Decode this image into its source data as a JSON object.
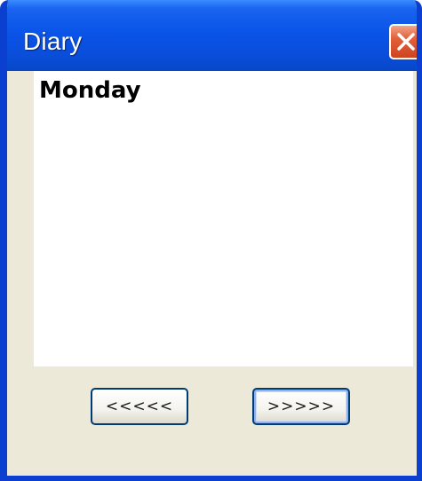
{
  "window": {
    "title": "Diary",
    "close_icon": "close-x-icon"
  },
  "content": {
    "text": "Monday"
  },
  "buttons": {
    "prev_label": "<<<<<",
    "next_label": ">>>>>"
  },
  "colors": {
    "titlebar": "#0a54e8",
    "close_button": "#e2603a",
    "window_body": "#ece9d8",
    "text_area": "#ffffff"
  }
}
